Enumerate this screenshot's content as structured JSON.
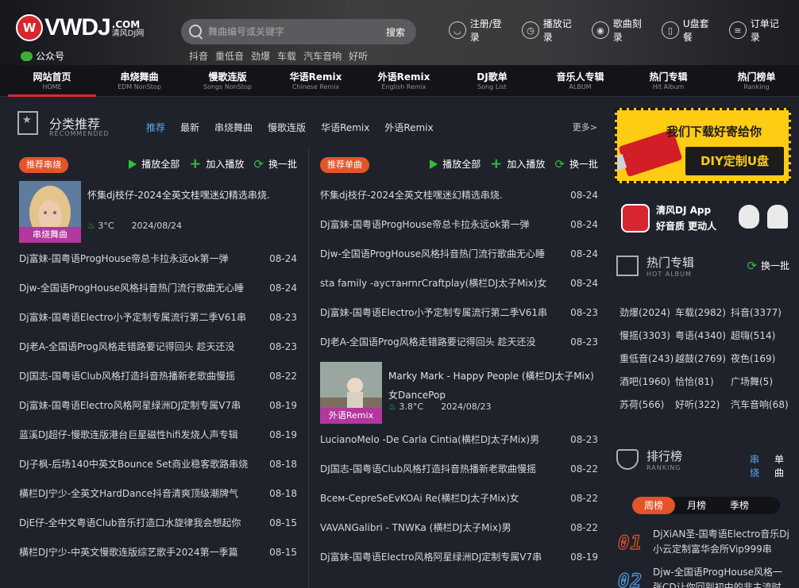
{
  "brand": {
    "logo_word": "VWDJ",
    "domain": ".COM",
    "subname": "清风DJ网"
  },
  "wechat_label": "公众号",
  "search": {
    "placeholder": "舞曲编号或关键字",
    "button": "搜索"
  },
  "hot_keys": [
    "抖音",
    "重低音",
    "劲爆",
    "车载",
    "汽车音响",
    "好听"
  ],
  "top_actions": [
    {
      "label": "注册/登录",
      "icon": "user-icon"
    },
    {
      "label": "播放记录",
      "icon": "clock-icon"
    },
    {
      "label": "歌曲刻录",
      "icon": "disc-icon"
    },
    {
      "label": "U盘套餐",
      "icon": "usb-icon"
    },
    {
      "label": "订单记录",
      "icon": "order-icon"
    }
  ],
  "nav": [
    {
      "label": "网站首页",
      "sub": "HOME"
    },
    {
      "label": "串烧舞曲",
      "sub": "EDM NonStop"
    },
    {
      "label": "慢歌连版",
      "sub": "Songs NonStop"
    },
    {
      "label": "华语Remix",
      "sub": "Chinese Remix"
    },
    {
      "label": "外语Remix",
      "sub": "English Remix"
    },
    {
      "label": "DJ歌单",
      "sub": "Song List"
    },
    {
      "label": "音乐人专辑",
      "sub": "ALBUM"
    },
    {
      "label": "热门专辑",
      "sub": "Hit Album"
    },
    {
      "label": "热门榜单",
      "sub": "Ranking"
    }
  ],
  "section": {
    "title": "分类推荐",
    "subtitle": "RECOMMENDED",
    "tabs": [
      "推荐",
      "最新",
      "串烧舞曲",
      "慢歌连版",
      "华语Remix",
      "外语Remix"
    ],
    "more": "更多>"
  },
  "controls": {
    "play_all": "播放全部",
    "add_play": "加入播放",
    "refresh": "换一批"
  },
  "left": {
    "pill": "推荐串烧",
    "featured": {
      "title": "怀集dj枝仔-2024全英文桂嘿迷幻精选串烧.",
      "tag": "串烧舞曲",
      "temp": "3°C",
      "date": "2024/08/24"
    },
    "rows": [
      {
        "t": "Dj富妹-国粤语ProgHouse帝总卡拉永远ok第一弹",
        "d": "08-24"
      },
      {
        "t": "Djw-全国语ProgHouse风格抖音热门流行歌曲无心睡",
        "d": "08-24"
      },
      {
        "t": "Dj富妹-国粤语Electro小予定制专属流行第二季V61串",
        "d": "08-23"
      },
      {
        "t": "DJ老A-全国语Prog风格走错路要记得回头 趁天还没",
        "d": "08-23"
      },
      {
        "t": "DJ国志-国粤语Club风格打造抖音热播新老歌曲慢摇",
        "d": "08-22"
      },
      {
        "t": "Dj富妹-国粤语Electro风格阿星绿洲DJ定制专属V7串",
        "d": "08-19"
      },
      {
        "t": "蓝溪DJ超仔-慢歌连版港台巨星磁性hifi发烧人声专辑",
        "d": "08-19"
      },
      {
        "t": "DJ子枫-后场140中英文Bounce Set商业稳客歌路串烧",
        "d": "08-18"
      },
      {
        "t": "橫栏DJ宁少-全英文HardDance抖音清爽顶级潮牌气",
        "d": "08-18"
      },
      {
        "t": "DjE仔-全中文粤语Club音乐打造口水旋律我会想起你",
        "d": "08-15"
      },
      {
        "t": "橫栏DJ宁少-中英文慢歌连版综艺歌手2024第一季篇",
        "d": "08-15"
      }
    ]
  },
  "right": {
    "pill": "推荐单曲",
    "rows_top": [
      {
        "t": "怀集dj枝仔-2024全英文桂嘿迷幻精选串烧.",
        "d": "08-24"
      },
      {
        "t": "Dj富妹-国粤语ProgHouse帝总卡拉永远ok第一弹",
        "d": "08-24"
      },
      {
        "t": "Djw-全国语ProgHouse风格抖音热门流行歌曲无心睡",
        "d": "08-24"
      },
      {
        "t": "sta family -аустанrnrCraftplay(横栏DJ太子Mix)女",
        "d": "08-24"
      },
      {
        "t": "Dj富妹-国粤语Electro小予定制专属流行第二季V61串",
        "d": "08-23"
      },
      {
        "t": "DJ老A-全国语Prog风格走错路要记得回头 趁天还没",
        "d": "08-23"
      }
    ],
    "featured": {
      "title": "Marky Mark - Happy People (橫栏DJ太子Mix)女DancePop",
      "tag": "外语Remix",
      "temp": "3.8°C",
      "date": "2024/08/23"
    },
    "rows_bottom": [
      {
        "t": "LucianoMelo -De Carla Cintia(横栏DJ太子Mix)男",
        "d": "08-23"
      },
      {
        "t": "DJ国志-国粤语Club风格打造抖音热播新老歌曲慢摇",
        "d": "08-22"
      },
      {
        "t": "Bceм-CepreSeEvKOAi Re(横栏DJ太子Mix)女",
        "d": "08-22"
      },
      {
        "t": "VAVANGalibri - TNWKa (横栏DJ太子Mix)男",
        "d": "08-22"
      },
      {
        "t": "Dj富妹-国粤语Electro风格阿星绿洲DJ定制专属V7串",
        "d": "08-19"
      }
    ]
  },
  "sidebar": {
    "ad": {
      "line1": "我们下载好寄给你",
      "line2": "DIY定制U盘"
    },
    "app": {
      "name": "清风DJ App",
      "tagline": "好音质  更动人"
    },
    "hot_album": {
      "title": "热门专辑",
      "subtitle": "HOT ALBUM",
      "refresh": "换一批"
    },
    "tags": [
      "劲爆(2024)",
      "车载(2982)",
      "抖音(3377)",
      "慢摇(3303)",
      "粤语(4340)",
      "超嗨(514)",
      "重低音(243)",
      "越鼓(2769)",
      "夜色(169)",
      "酒吧(1960)",
      "恰恰(81)",
      "广场舞(5)",
      "苏荷(566)",
      "好听(322)",
      "汽车音响(68)"
    ],
    "ranking": {
      "title": "排行榜",
      "subtitle": "RANKING",
      "tabs": [
        "串烧",
        "单曲"
      ],
      "periods": [
        "周榜",
        "月榜",
        "季榜"
      ]
    },
    "rank_items": [
      {
        "num": "01",
        "t": "DjXiAN圣-国粤语Electro音乐Dj小云定制富华会所Vip999串"
      },
      {
        "num": "02",
        "t": "Djw-全国语ProgHouse风格一张CD让你回到初中的非主流时"
      }
    ]
  },
  "colors": {
    "accent": "#e4542a",
    "play_green": "#2fbf3c",
    "link_blue": "#5ca9f5",
    "nav_active": "#d92a31",
    "tag_pink": "#b3379e"
  }
}
